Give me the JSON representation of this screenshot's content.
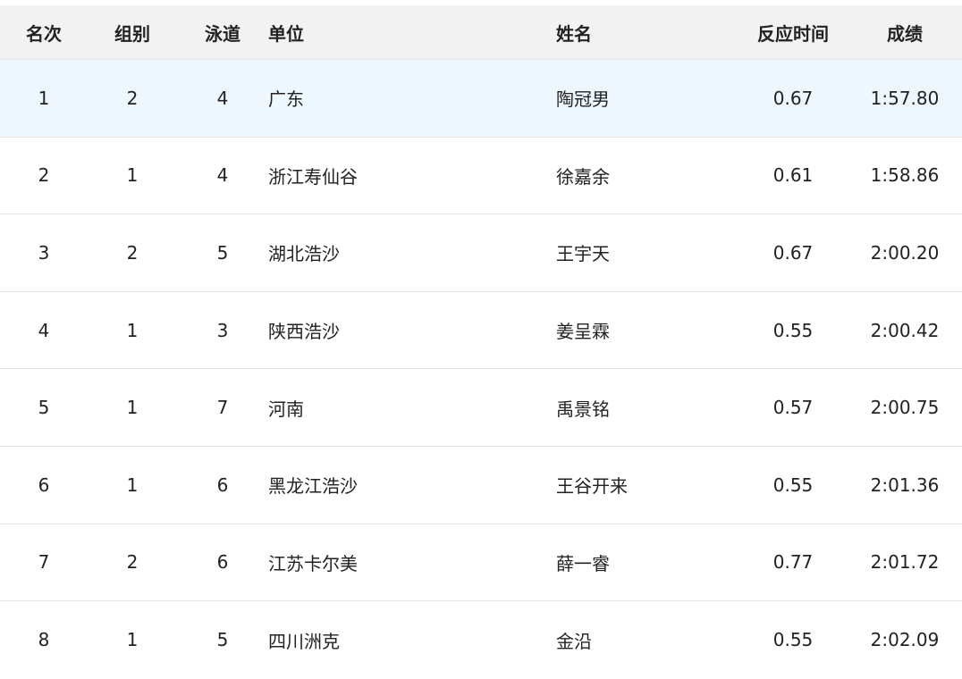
{
  "table": {
    "headers": {
      "rank": "名次",
      "group": "组别",
      "lane": "泳道",
      "unit": "单位",
      "name": "姓名",
      "reaction": "反应时间",
      "result": "成绩"
    },
    "rows": [
      {
        "rank": "1",
        "group": "2",
        "lane": "4",
        "unit": "广东",
        "name": "陶冠男",
        "reaction": "0.67",
        "result": "1:57.80"
      },
      {
        "rank": "2",
        "group": "1",
        "lane": "4",
        "unit": "浙江寿仙谷",
        "name": "徐嘉余",
        "reaction": "0.61",
        "result": "1:58.86"
      },
      {
        "rank": "3",
        "group": "2",
        "lane": "5",
        "unit": "湖北浩沙",
        "name": "王宇天",
        "reaction": "0.67",
        "result": "2:00.20"
      },
      {
        "rank": "4",
        "group": "1",
        "lane": "3",
        "unit": "陕西浩沙",
        "name": "姜呈霖",
        "reaction": "0.55",
        "result": "2:00.42"
      },
      {
        "rank": "5",
        "group": "1",
        "lane": "7",
        "unit": "河南",
        "name": "禹景铭",
        "reaction": "0.57",
        "result": "2:00.75"
      },
      {
        "rank": "6",
        "group": "1",
        "lane": "6",
        "unit": "黑龙江浩沙",
        "name": "王谷开来",
        "reaction": "0.55",
        "result": "2:01.36"
      },
      {
        "rank": "7",
        "group": "2",
        "lane": "6",
        "unit": "江苏卡尔美",
        "name": "薛一睿",
        "reaction": "0.77",
        "result": "2:01.72"
      },
      {
        "rank": "8",
        "group": "1",
        "lane": "5",
        "unit": "四川洲克",
        "name": "金沿",
        "reaction": "0.55",
        "result": "2:02.09"
      }
    ]
  },
  "colors": {
    "header_bg": "#f2f2f2",
    "highlight_row_bg": "#eef7fd",
    "border": "#e6e6e6",
    "text": "#222222"
  }
}
